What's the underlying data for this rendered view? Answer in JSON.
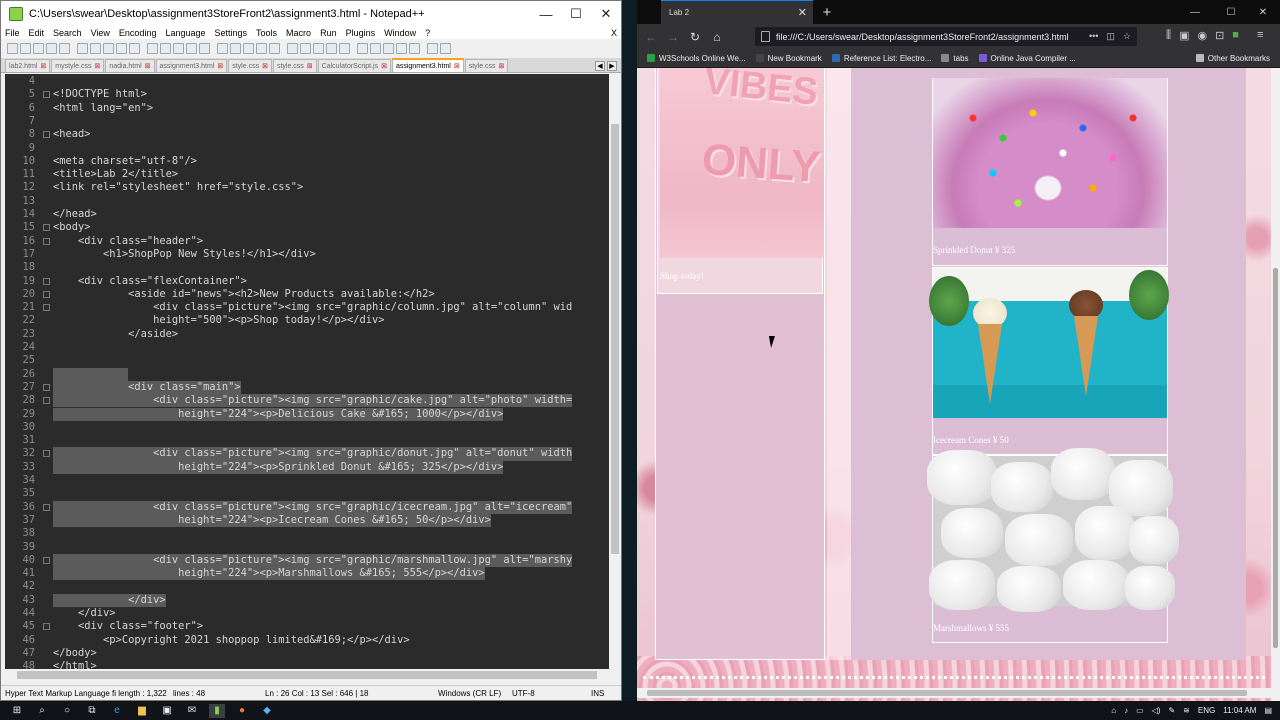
{
  "notepad": {
    "title": "C:\\Users\\swear\\Desktop\\assignment3StoreFront2\\assignment3.html - Notepad++",
    "menu": [
      "File",
      "Edit",
      "Search",
      "View",
      "Encoding",
      "Language",
      "Settings",
      "Tools",
      "Macro",
      "Run",
      "Plugins",
      "Window",
      "?"
    ],
    "menu_close": "X",
    "tabs": [
      "lab2.html",
      "mystyle.css",
      "nadia.html",
      "assignment3.html",
      "style.css",
      "style.css",
      "CalculatorScript.js",
      "assignment3.html",
      "style.css"
    ],
    "active_tab_index": 7,
    "status": {
      "lang": "Hyper Text Markup Language fi length : 1,322",
      "lines": "lines : 48",
      "pos": "Ln : 26   Col : 13   Sel : 646 | 18",
      "eol": "Windows (CR LF)",
      "enc": "UTF-8",
      "ins": "INS"
    }
  },
  "code_lines": [
    {
      "n": "4",
      "t": ""
    },
    {
      "n": "5",
      "t": "<!DOCTYPE html>"
    },
    {
      "n": "6",
      "t": "<html lang=\"en\">"
    },
    {
      "n": "7",
      "t": ""
    },
    {
      "n": "8",
      "t": "<head>"
    },
    {
      "n": "9",
      "t": ""
    },
    {
      "n": "10",
      "t": "<meta charset=\"utf-8\"/>"
    },
    {
      "n": "11",
      "t": "<title>Lab 2</title>"
    },
    {
      "n": "12",
      "t": "<link rel=\"stylesheet\" href=\"style.css\">"
    },
    {
      "n": "13",
      "t": ""
    },
    {
      "n": "14",
      "t": "</head>"
    },
    {
      "n": "15",
      "t": "<body>"
    },
    {
      "n": "16",
      "t": "    <div class=\"header\">"
    },
    {
      "n": "17",
      "t": "        <h1>ShopPop New Styles!</h1></div>"
    },
    {
      "n": "18",
      "t": ""
    },
    {
      "n": "19",
      "t": "    <div class=\"flexContainer\">"
    },
    {
      "n": "20",
      "t": "            <aside id=\"news\"><h2>New Products available:</h2>"
    },
    {
      "n": "21",
      "t": "                <div class=\"picture\"><img src=\"graphic/column.jpg\" alt=\"column\" wid"
    },
    {
      "n": "22",
      "t": "                height=\"500\"><p>Shop today!</p></div>"
    },
    {
      "n": "23",
      "t": "            </aside>"
    },
    {
      "n": "24",
      "t": ""
    },
    {
      "n": "25",
      "t": ""
    },
    {
      "n": "26",
      "t": "            "
    },
    {
      "n": "27",
      "t": "            <div class=\"main\">"
    },
    {
      "n": "28",
      "t": "                <div class=\"picture\"><img src=\"graphic/cake.jpg\" alt=\"photo\" width="
    },
    {
      "n": "29",
      "t": "                    height=\"224\"><p>Delicious Cake &#165; 1000</p></div>"
    },
    {
      "n": "30",
      "t": ""
    },
    {
      "n": "31",
      "t": ""
    },
    {
      "n": "32",
      "t": "                <div class=\"picture\"><img src=\"graphic/donut.jpg\" alt=\"donut\" width"
    },
    {
      "n": "33",
      "t": "                    height=\"224\"><p>Sprinkled Donut &#165; 325</p></div>"
    },
    {
      "n": "34",
      "t": ""
    },
    {
      "n": "35",
      "t": ""
    },
    {
      "n": "36",
      "t": "                <div class=\"picture\"><img src=\"graphic/icecream.jpg\" alt=\"icecream\""
    },
    {
      "n": "37",
      "t": "                    height=\"224\"><p>Icecream Cones &#165; 50</p></div>"
    },
    {
      "n": "38",
      "t": ""
    },
    {
      "n": "39",
      "t": ""
    },
    {
      "n": "40",
      "t": "                <div class=\"picture\"><img src=\"graphic/marshmallow.jpg\" alt=\"marshy"
    },
    {
      "n": "41",
      "t": "                    height=\"224\"><p>Marshmallows &#165; 555</p></div>"
    },
    {
      "n": "42",
      "t": ""
    },
    {
      "n": "43",
      "t": "            </div>"
    },
    {
      "n": "44",
      "t": "    </div>"
    },
    {
      "n": "45",
      "t": "    <div class=\"footer\">"
    },
    {
      "n": "46",
      "t": "        <p>Copyright 2021 shoppop limited&#169;</p></div>"
    },
    {
      "n": "47",
      "t": "</body>"
    },
    {
      "n": "48",
      "t": "</html>"
    }
  ],
  "firefox": {
    "tab_title": "Lab 2",
    "tab_close": "✕",
    "url": "file:///C:/Users/swear/Desktop/assignment3StoreFront2/assignment3.html",
    "bookmarks": [
      "W3Schools Online We...",
      "New Bookmark",
      "Reference List: Electro...",
      "tabs",
      "Online Java Compiler ..."
    ],
    "other_bookmarks": "Other Bookmarks"
  },
  "page": {
    "aside_caption": "Shop today!",
    "column_img_text_1": "VIBES",
    "column_img_text_2": "ONLY",
    "products": [
      {
        "caption": "Sprinkled Donut ¥ 325"
      },
      {
        "caption": "Icecream Cones ¥ 50"
      },
      {
        "caption": "Marshmallows ¥ 555"
      }
    ]
  },
  "taskbar": {
    "lang": "ENG",
    "time": "11:04 AM"
  }
}
